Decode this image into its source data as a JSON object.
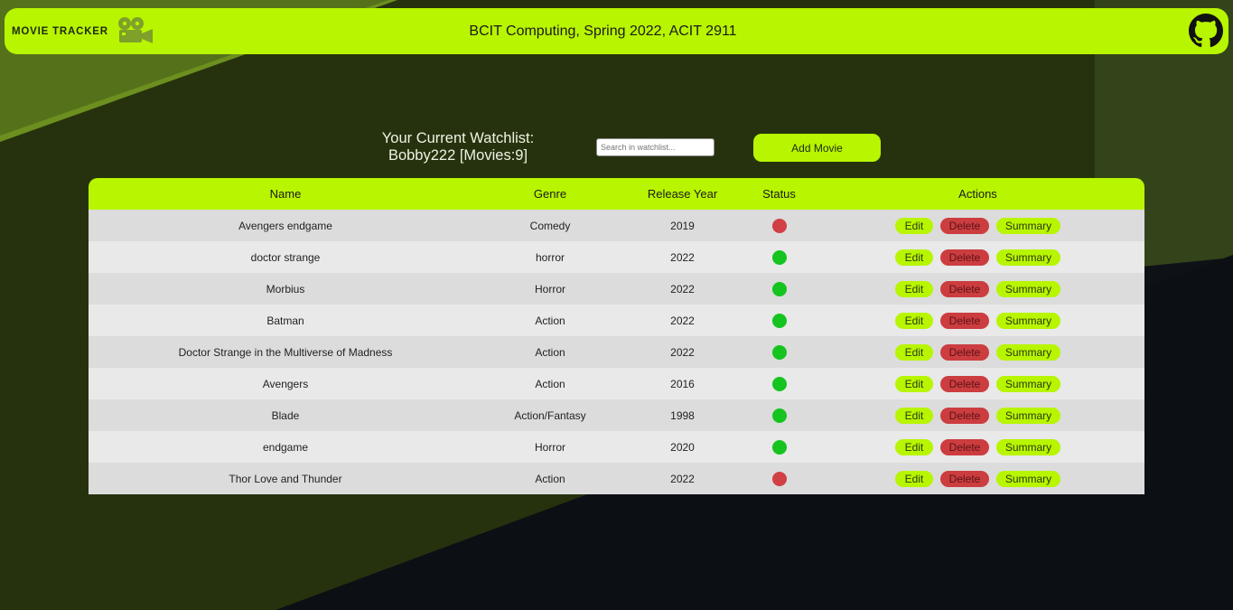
{
  "navbar": {
    "brand": "MOVIE TRACKER",
    "brand_icon": "movie-camera-icon",
    "title": "BCIT Computing, Spring 2022, ACIT 2911",
    "github_icon": "github-icon"
  },
  "watchlist": {
    "heading_line1": "Your Current Watchlist:",
    "heading_line2": "Bobby222 [Movies:9]"
  },
  "search": {
    "placeholder": "Search in watchlist..."
  },
  "add_movie_label": "Add Movie",
  "table": {
    "headers": {
      "name": "Name",
      "genre": "Genre",
      "year": "Release Year",
      "status": "Status",
      "actions": "Actions"
    },
    "action_labels": {
      "edit": "Edit",
      "delete": "Delete",
      "summary": "Summary"
    },
    "rows": [
      {
        "name": "Avengers endgame",
        "genre": "Comedy",
        "year": "2019",
        "status": "red"
      },
      {
        "name": "doctor strange",
        "genre": "horror",
        "year": "2022",
        "status": "green"
      },
      {
        "name": "Morbius",
        "genre": "Horror",
        "year": "2022",
        "status": "green"
      },
      {
        "name": "Batman",
        "genre": "Action",
        "year": "2022",
        "status": "green"
      },
      {
        "name": "Doctor Strange in the Multiverse of Madness",
        "genre": "Action",
        "year": "2022",
        "status": "green"
      },
      {
        "name": "Avengers",
        "genre": "Action",
        "year": "2016",
        "status": "green"
      },
      {
        "name": "Blade",
        "genre": "Action/Fantasy",
        "year": "1998",
        "status": "green"
      },
      {
        "name": "endgame",
        "genre": "Horror",
        "year": "2020",
        "status": "green"
      },
      {
        "name": "Thor Love and Thunder",
        "genre": "Action",
        "year": "2022",
        "status": "red"
      }
    ]
  },
  "colors": {
    "accent": "#b8f500",
    "status_red": "#d04044",
    "status_green": "#15c41f",
    "delete": "#cc3d40"
  }
}
